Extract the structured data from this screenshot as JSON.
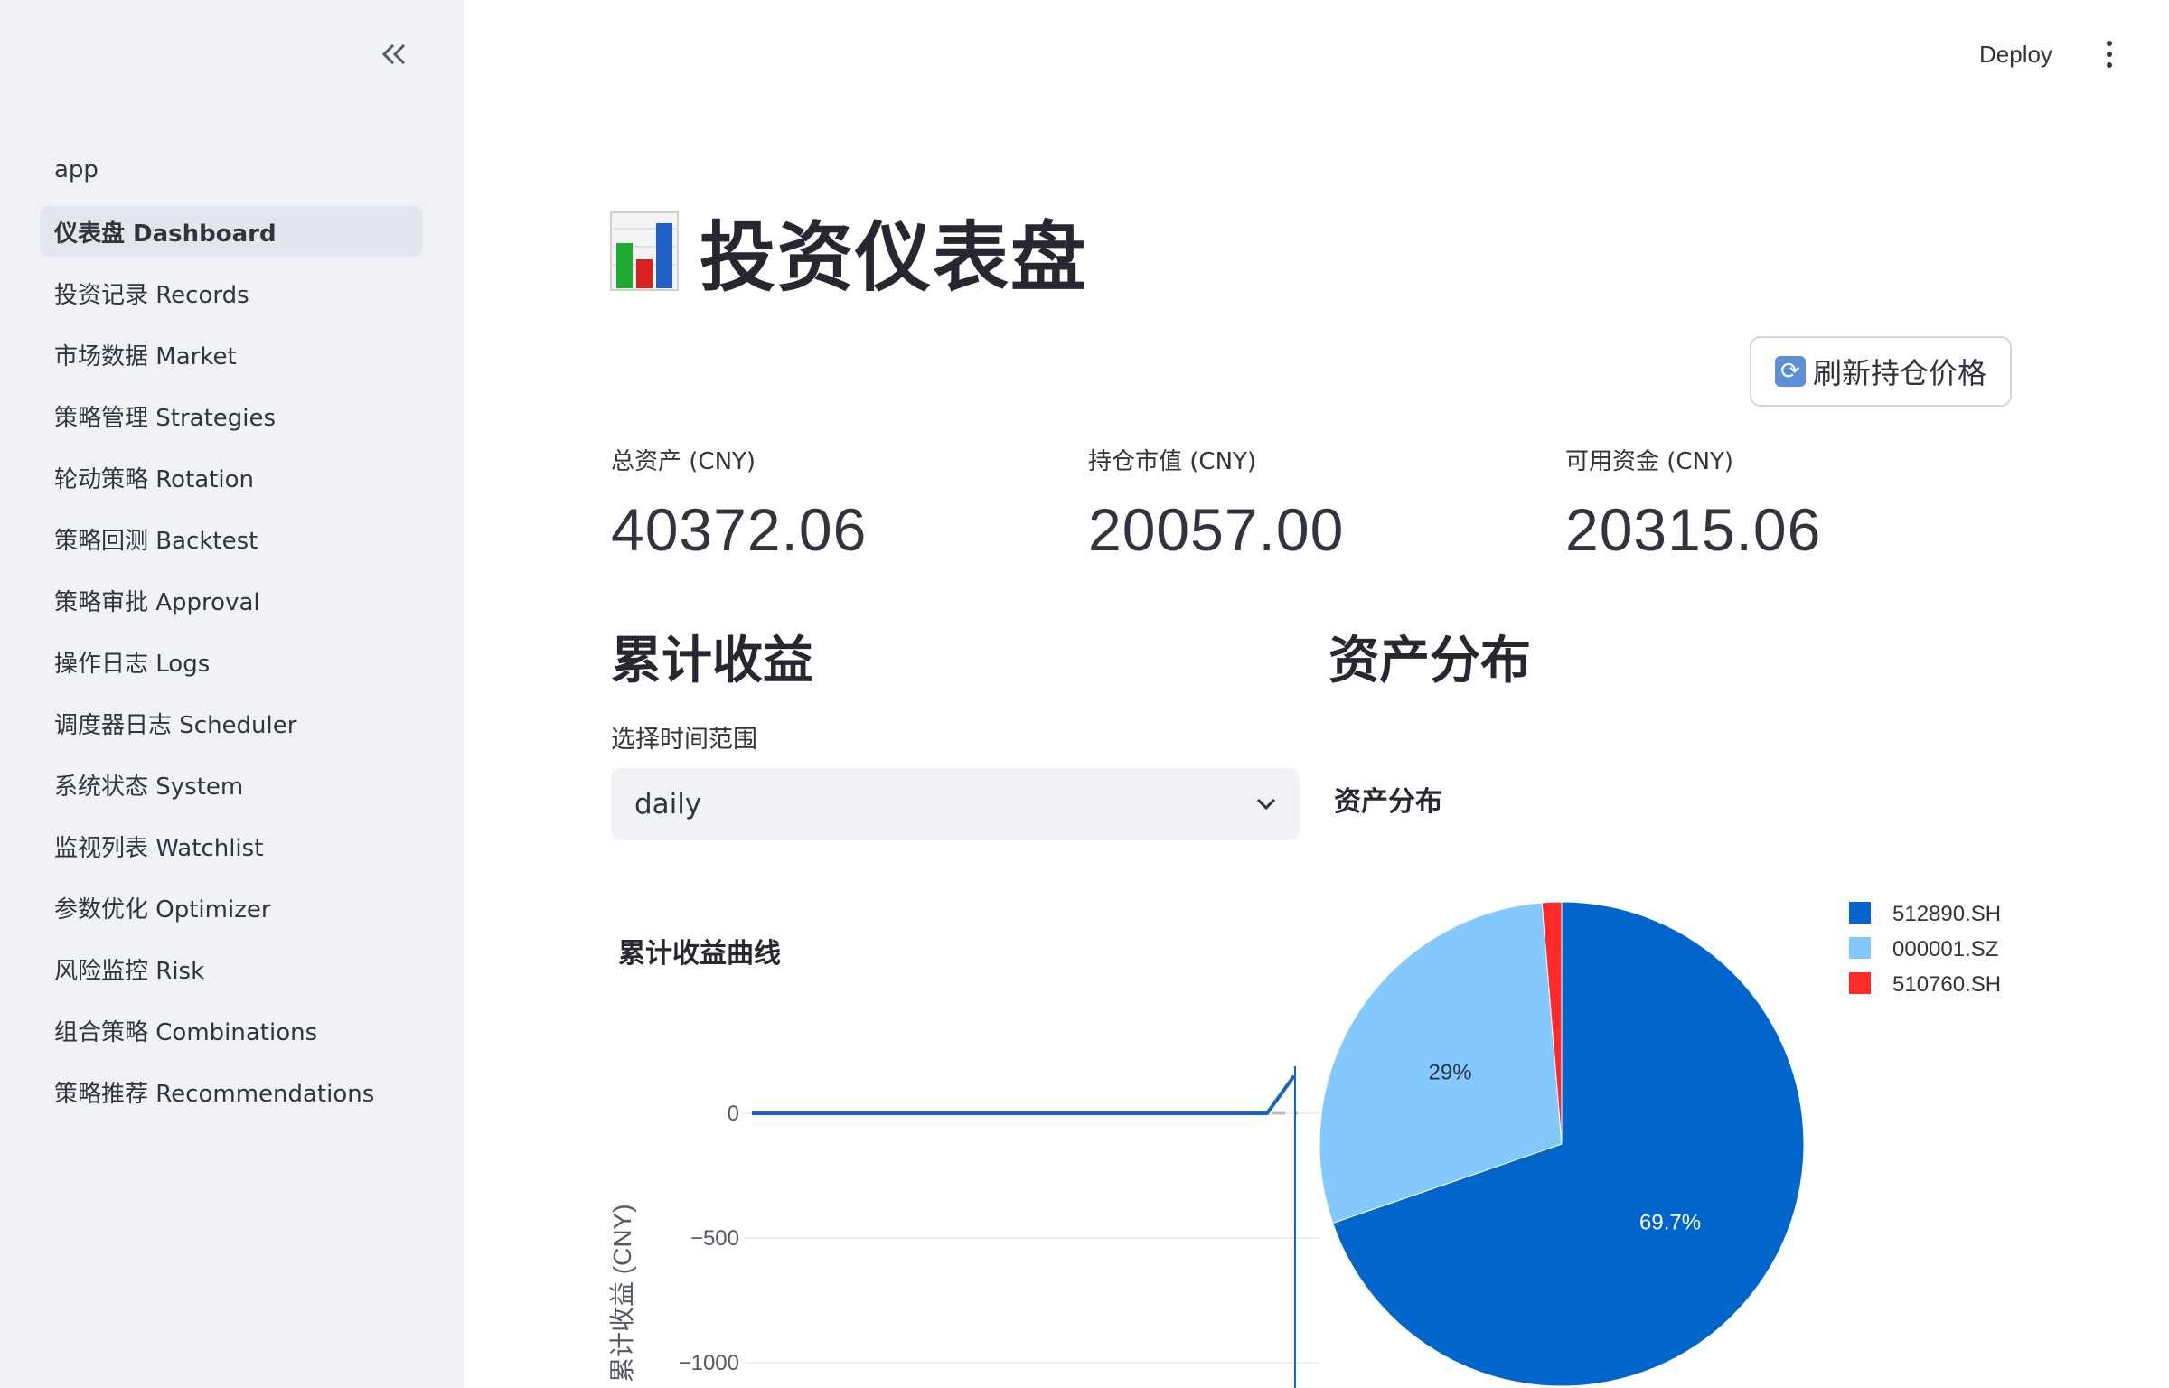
{
  "sidebar": {
    "collapse_icon": "double-chevron-left-icon",
    "items": [
      {
        "label": "app"
      },
      {
        "label": "仪表盘 Dashboard"
      },
      {
        "label": "投资记录 Records"
      },
      {
        "label": "市场数据 Market"
      },
      {
        "label": "策略管理 Strategies"
      },
      {
        "label": "轮动策略 Rotation"
      },
      {
        "label": "策略回测 Backtest"
      },
      {
        "label": "策略审批 Approval"
      },
      {
        "label": "操作日志 Logs"
      },
      {
        "label": "调度器日志 Scheduler"
      },
      {
        "label": "系统状态 System"
      },
      {
        "label": "监视列表 Watchlist"
      },
      {
        "label": "参数优化 Optimizer"
      },
      {
        "label": "风险监控 Risk"
      },
      {
        "label": "组合策略 Combinations"
      },
      {
        "label": "策略推荐 Recommendations"
      }
    ],
    "active_index": 1
  },
  "header": {
    "deploy_label": "Deploy",
    "menu_icon": "kebab-menu-icon"
  },
  "main": {
    "title": "投资仪表盘",
    "title_icon": "bar-chart-icon",
    "refresh_button": "刷新持仓价格",
    "metrics": [
      {
        "label": "总资产 (CNY)",
        "value": "40372.06"
      },
      {
        "label": "持仓市值 (CNY)",
        "value": "20057.00"
      },
      {
        "label": "可用资金 (CNY)",
        "value": "20315.06"
      }
    ],
    "cumulative": {
      "header": "累计收益",
      "select_label": "选择时间范围",
      "select_value": "daily",
      "chart_title": "累计收益曲线"
    },
    "distribution": {
      "header": "资产分布",
      "chart_title": "资产分布"
    }
  },
  "chart_data": [
    {
      "type": "line",
      "title": "累计收益曲线",
      "xlabel": "",
      "ylabel": "累计收益 (CNY)",
      "yticks": [
        0,
        -500,
        -1000
      ],
      "series": [
        {
          "values": [
            0,
            0,
            0,
            0,
            0,
            0,
            0,
            0,
            0,
            0,
            0,
            0,
            0,
            0,
            0,
            0,
            0,
            0,
            0,
            0,
            150
          ]
        }
      ],
      "reference_line": 0,
      "colors": {
        "line": "#1565c0",
        "reference": "#bdbdbd"
      }
    },
    {
      "type": "pie",
      "title": "资产分布",
      "legend_position": "top-right",
      "slices": [
        {
          "name": "512890.SH",
          "value": 69.7,
          "label": "69.7%",
          "color": "#0066cc"
        },
        {
          "name": "000001.SZ",
          "value": 29.0,
          "label": "29%",
          "color": "#83c9ff"
        },
        {
          "name": "510760.SH",
          "value": 1.3,
          "label": "",
          "color": "#ff2b2b"
        }
      ]
    }
  ]
}
